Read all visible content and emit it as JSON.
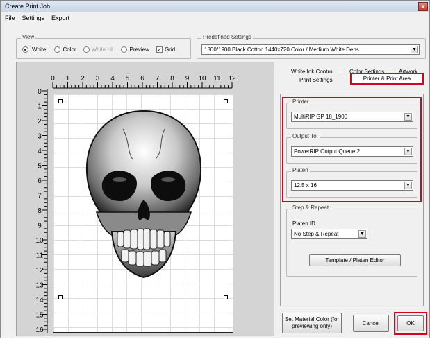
{
  "window": {
    "title": "Create Print Job",
    "close_glyph": "x"
  },
  "menu": [
    "File",
    "Settings",
    "Export"
  ],
  "view": {
    "label": "View",
    "options": {
      "white": "White",
      "color": "Color",
      "white_hl": "White HL",
      "preview": "Preview"
    },
    "selected": "White",
    "grid_label": "Grid",
    "grid_checked": true
  },
  "predefined": {
    "label": "Predefined Settings",
    "value": "1800/1900 Black Cotton 1440x720 Color / Medium White Dens."
  },
  "ruler": {
    "h_ticks": [
      "0",
      "1",
      "2",
      "3",
      "4",
      "5",
      "6",
      "7",
      "8",
      "9",
      "10",
      "11",
      "12"
    ],
    "v_ticks": [
      "0",
      "1",
      "2",
      "3",
      "4",
      "5",
      "6",
      "7",
      "8",
      "9",
      "10",
      "11",
      "12",
      "13",
      "14",
      "15",
      "16"
    ]
  },
  "tabs": {
    "row1": [
      "White Ink Control",
      "Color Settings",
      "Artwork"
    ],
    "row2": [
      "Print Settings",
      "Printer & Print Area"
    ],
    "active": "Printer & Print Area"
  },
  "printer": {
    "label": "Printer",
    "value": "MultiRIP GP 18_1900"
  },
  "output": {
    "label": "Output To:",
    "value": "PowerRIP Output Queue 2"
  },
  "platen": {
    "label": "Platen",
    "value": "12.5 x 16"
  },
  "step_repeat": {
    "label": "Step & Repeat",
    "platen_id_label": "Platen ID",
    "platen_id_value": "No Step & Repeat",
    "editor_button": "Template / Platen Editor"
  },
  "buttons": {
    "material": "Set Material Color (for previewing only)",
    "cancel": "Cancel",
    "ok": "OK"
  },
  "colors": {
    "highlight": "#d9001b",
    "canvas_bg": "#d4d4d4"
  }
}
